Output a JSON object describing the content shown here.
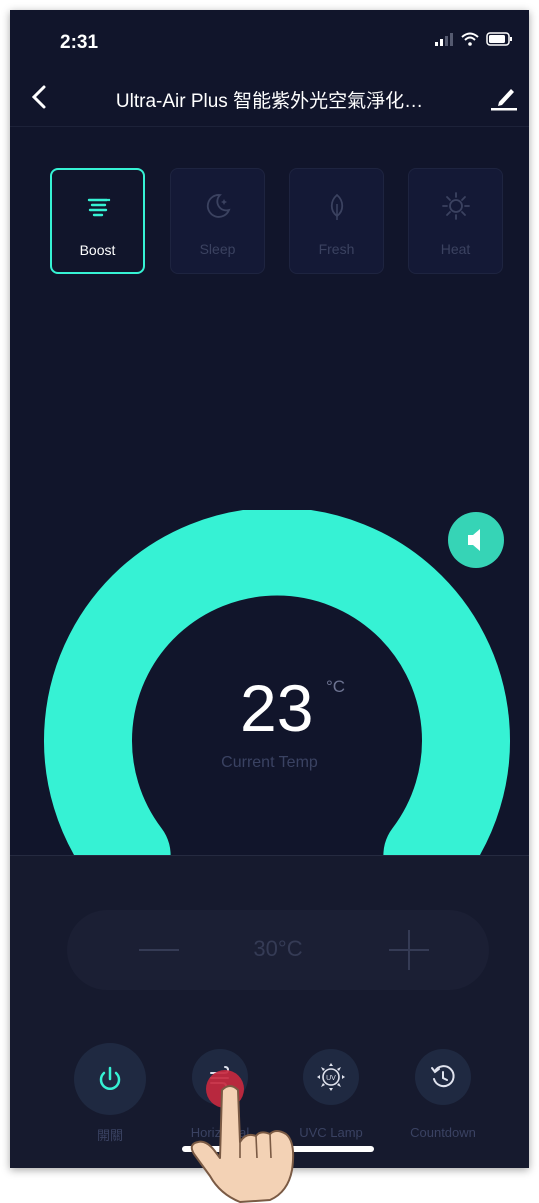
{
  "status_bar": {
    "time": "2:31"
  },
  "nav": {
    "title": "Ultra-Air Plus 智能紫外光空氣淨化…",
    "back_icon": "chevron-left-icon",
    "edit_icon": "pencil-icon"
  },
  "modes": [
    {
      "label": "Boost",
      "icon": "fan-lines-icon",
      "active": true
    },
    {
      "label": "Sleep",
      "icon": "moon-icon",
      "active": false
    },
    {
      "label": "Fresh",
      "icon": "leaf-icon",
      "active": false
    },
    {
      "label": "Heat",
      "icon": "sun-icon",
      "active": false
    }
  ],
  "gauge": {
    "value": "23",
    "unit": "°C",
    "label": "Current Temp"
  },
  "setpoint": {
    "value": "30°C",
    "minus": "—",
    "plus": "+"
  },
  "functions": [
    {
      "label": "開關",
      "icon": "power-icon"
    },
    {
      "label": "Horizontal",
      "icon": "wind-icon"
    },
    {
      "label": "UVC Lamp",
      "icon": "uv-lamp-icon"
    },
    {
      "label": "Countdown",
      "icon": "timer-icon"
    }
  ],
  "colors": {
    "accent": "#36f2d4",
    "background": "#11152b",
    "panel": "#161a2e",
    "tap_indicator": "#c6283e"
  }
}
